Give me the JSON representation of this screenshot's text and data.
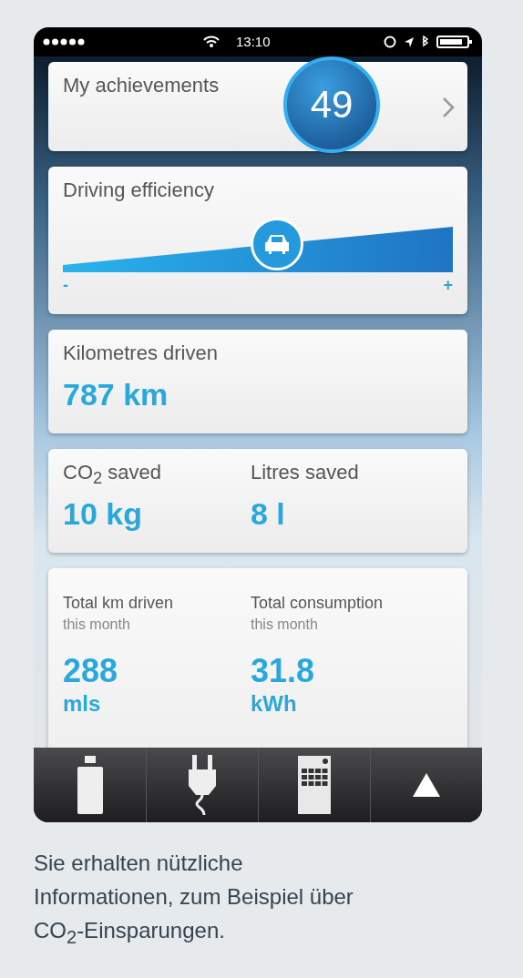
{
  "status_bar": {
    "time": "13:10"
  },
  "achievements": {
    "title": "My achievements",
    "count": "49"
  },
  "efficiency": {
    "title": "Driving efficiency",
    "level": 0.55,
    "min_label": "-",
    "max_label": "+"
  },
  "distance": {
    "title": "Kilometres driven",
    "value": "787 km"
  },
  "savings": [
    {
      "label": "CO$_{2}$ saved",
      "value": "10 kg"
    },
    {
      "label": "Litres saved",
      "value": "8 l"
    }
  ],
  "monthly": [
    {
      "label": "Total km driven",
      "sublabel": "this month",
      "value": "288",
      "unit": "mls"
    },
    {
      "label": "Total consumption",
      "sublabel": "this month",
      "value": "31.8",
      "unit": "kWh"
    }
  ],
  "tab_bar": [
    {
      "kind": "battery"
    },
    {
      "kind": "plug"
    },
    {
      "kind": "remote"
    },
    {
      "kind": "up"
    }
  ],
  "caption": "Sie erhalten nützliche Informationen, zum Beispiel über CO$_{2}$-Einsparungen."
}
